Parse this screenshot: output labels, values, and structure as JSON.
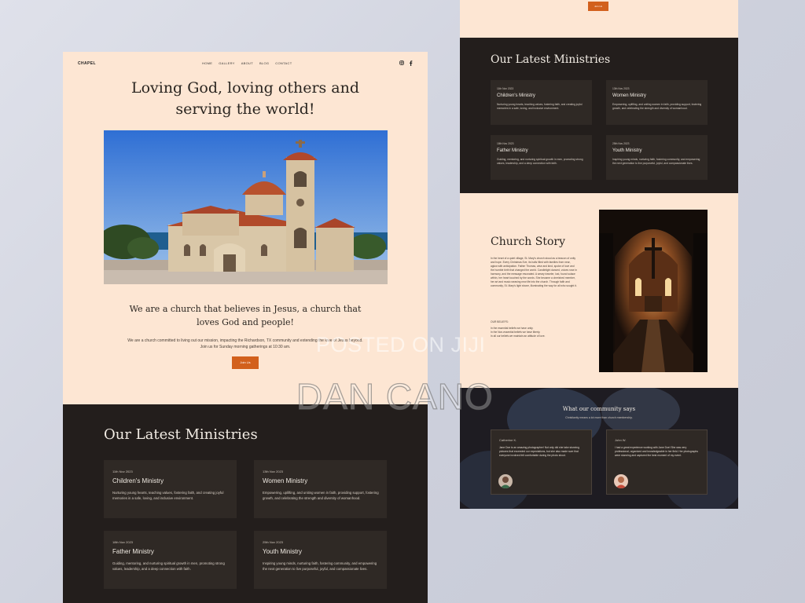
{
  "nav": {
    "brand": "CHAPEL",
    "items": [
      "HOME",
      "GALLERY",
      "ABOUT",
      "BLOG",
      "CONTACT"
    ],
    "social_icons": [
      "instagram-icon",
      "facebook-icon"
    ]
  },
  "hero": {
    "title": "Loving God, loving others and serving the world!",
    "tagline": "We are a church that believes in Jesus, a church that loves God and people!",
    "description": "We are a church committed to living out our mission, impacting the Richardson, TX community and extending the love of Jesus beyond. Join us for Sunday morning gatherings at 10:30 am.",
    "button_label": "Join Us"
  },
  "ministries": {
    "title": "Our Latest Ministries",
    "items": [
      {
        "date": "11th Nov 2023",
        "title": "Children's Ministry",
        "description": "Nurturing young hearts, teaching values, fostering faith, and creating joyful memories in a safe, loving, and inclusive environment."
      },
      {
        "date": "13th Nov 2023",
        "title": "Women Ministry",
        "description": "Empowering, uplifting, and uniting women in faith, providing support, fostering growth, and celebrating the strength and diversity of womanhood."
      },
      {
        "date": "18th Nov 2023",
        "title": "Father Ministry",
        "description": "Guiding, mentoring, and nurturing spiritual growth in men, promoting strong values, leadership, and a deep connection with faith."
      },
      {
        "date": "25th Nov 2023",
        "title": "Youth Ministry",
        "description": "Inspiring young minds, nurturing faith, fostering community, and empowering the next generation to live purposeful, joyful, and compassionate lives."
      }
    ]
  },
  "right_page": {
    "top_button_label": "Join Us"
  },
  "story": {
    "title": "Church Story",
    "text": "In the heart of a quiet village, St. Mary's church stood as a beacon of unity and hope. Every Christmas Eve, its halls filled with families from near, aglow with anticipation. Father Thomas, wise and kind, spoke of love and the humble birth that changed the world. Candlelight danced, voices rose in harmony, and the message resonated. A weary traveler, lost, found solace within, her heart touched by the words. She became a cherished member, her art and music weaving new life into the church. Through faith and community, St. Mary's light shone, illuminating the way for all who sought it.",
    "beliefs_label": "OUR BELIEFS:",
    "beliefs": [
      "In the essential beliefs we have unity.",
      "In the Non-essential beliefs we have liberty.",
      "In all our beliefs we maintain an attitude of love."
    ]
  },
  "community": {
    "title": "What our community says",
    "subtitle": "Christianity means a lot more than church membership.",
    "testimonials": [
      {
        "name": "Catherine K.",
        "text": "Jane Doe is an amazing photographer! Not only did she take stunning pictures that exceeded our expectations, but she also made sure that everyone involved felt comfortable during the photo shoot."
      },
      {
        "name": "John W.",
        "text": "I had a great experience working with Jane Doe! She was very professional, organized and knowledgeable in her field. Her photographs were stunning and captured the best moment of my event."
      }
    ]
  },
  "watermark": {
    "line1": "POSTED ON JIJI",
    "line2": "DAN CANO"
  },
  "colors": {
    "cream": "#fde6d3",
    "dark": "#231e1c",
    "card": "#2f2925",
    "accent": "#d2601c"
  }
}
